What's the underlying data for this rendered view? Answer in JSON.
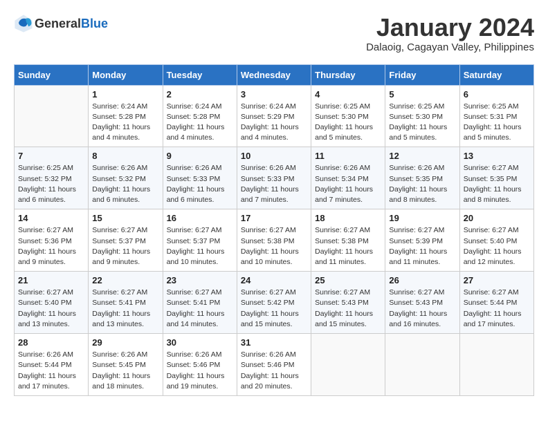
{
  "header": {
    "logo_general": "General",
    "logo_blue": "Blue",
    "month": "January 2024",
    "location": "Dalaoig, Cagayan Valley, Philippines"
  },
  "columns": [
    "Sunday",
    "Monday",
    "Tuesday",
    "Wednesday",
    "Thursday",
    "Friday",
    "Saturday"
  ],
  "weeks": [
    [
      {
        "num": "",
        "detail": ""
      },
      {
        "num": "1",
        "detail": "Sunrise: 6:24 AM\nSunset: 5:28 PM\nDaylight: 11 hours\nand 4 minutes."
      },
      {
        "num": "2",
        "detail": "Sunrise: 6:24 AM\nSunset: 5:28 PM\nDaylight: 11 hours\nand 4 minutes."
      },
      {
        "num": "3",
        "detail": "Sunrise: 6:24 AM\nSunset: 5:29 PM\nDaylight: 11 hours\nand 4 minutes."
      },
      {
        "num": "4",
        "detail": "Sunrise: 6:25 AM\nSunset: 5:30 PM\nDaylight: 11 hours\nand 5 minutes."
      },
      {
        "num": "5",
        "detail": "Sunrise: 6:25 AM\nSunset: 5:30 PM\nDaylight: 11 hours\nand 5 minutes."
      },
      {
        "num": "6",
        "detail": "Sunrise: 6:25 AM\nSunset: 5:31 PM\nDaylight: 11 hours\nand 5 minutes."
      }
    ],
    [
      {
        "num": "7",
        "detail": "Sunrise: 6:25 AM\nSunset: 5:32 PM\nDaylight: 11 hours\nand 6 minutes."
      },
      {
        "num": "8",
        "detail": "Sunrise: 6:26 AM\nSunset: 5:32 PM\nDaylight: 11 hours\nand 6 minutes."
      },
      {
        "num": "9",
        "detail": "Sunrise: 6:26 AM\nSunset: 5:33 PM\nDaylight: 11 hours\nand 6 minutes."
      },
      {
        "num": "10",
        "detail": "Sunrise: 6:26 AM\nSunset: 5:33 PM\nDaylight: 11 hours\nand 7 minutes."
      },
      {
        "num": "11",
        "detail": "Sunrise: 6:26 AM\nSunset: 5:34 PM\nDaylight: 11 hours\nand 7 minutes."
      },
      {
        "num": "12",
        "detail": "Sunrise: 6:26 AM\nSunset: 5:35 PM\nDaylight: 11 hours\nand 8 minutes."
      },
      {
        "num": "13",
        "detail": "Sunrise: 6:27 AM\nSunset: 5:35 PM\nDaylight: 11 hours\nand 8 minutes."
      }
    ],
    [
      {
        "num": "14",
        "detail": "Sunrise: 6:27 AM\nSunset: 5:36 PM\nDaylight: 11 hours\nand 9 minutes."
      },
      {
        "num": "15",
        "detail": "Sunrise: 6:27 AM\nSunset: 5:37 PM\nDaylight: 11 hours\nand 9 minutes."
      },
      {
        "num": "16",
        "detail": "Sunrise: 6:27 AM\nSunset: 5:37 PM\nDaylight: 11 hours\nand 10 minutes."
      },
      {
        "num": "17",
        "detail": "Sunrise: 6:27 AM\nSunset: 5:38 PM\nDaylight: 11 hours\nand 10 minutes."
      },
      {
        "num": "18",
        "detail": "Sunrise: 6:27 AM\nSunset: 5:38 PM\nDaylight: 11 hours\nand 11 minutes."
      },
      {
        "num": "19",
        "detail": "Sunrise: 6:27 AM\nSunset: 5:39 PM\nDaylight: 11 hours\nand 11 minutes."
      },
      {
        "num": "20",
        "detail": "Sunrise: 6:27 AM\nSunset: 5:40 PM\nDaylight: 11 hours\nand 12 minutes."
      }
    ],
    [
      {
        "num": "21",
        "detail": "Sunrise: 6:27 AM\nSunset: 5:40 PM\nDaylight: 11 hours\nand 13 minutes."
      },
      {
        "num": "22",
        "detail": "Sunrise: 6:27 AM\nSunset: 5:41 PM\nDaylight: 11 hours\nand 13 minutes."
      },
      {
        "num": "23",
        "detail": "Sunrise: 6:27 AM\nSunset: 5:41 PM\nDaylight: 11 hours\nand 14 minutes."
      },
      {
        "num": "24",
        "detail": "Sunrise: 6:27 AM\nSunset: 5:42 PM\nDaylight: 11 hours\nand 15 minutes."
      },
      {
        "num": "25",
        "detail": "Sunrise: 6:27 AM\nSunset: 5:43 PM\nDaylight: 11 hours\nand 15 minutes."
      },
      {
        "num": "26",
        "detail": "Sunrise: 6:27 AM\nSunset: 5:43 PM\nDaylight: 11 hours\nand 16 minutes."
      },
      {
        "num": "27",
        "detail": "Sunrise: 6:27 AM\nSunset: 5:44 PM\nDaylight: 11 hours\nand 17 minutes."
      }
    ],
    [
      {
        "num": "28",
        "detail": "Sunrise: 6:26 AM\nSunset: 5:44 PM\nDaylight: 11 hours\nand 17 minutes."
      },
      {
        "num": "29",
        "detail": "Sunrise: 6:26 AM\nSunset: 5:45 PM\nDaylight: 11 hours\nand 18 minutes."
      },
      {
        "num": "30",
        "detail": "Sunrise: 6:26 AM\nSunset: 5:46 PM\nDaylight: 11 hours\nand 19 minutes."
      },
      {
        "num": "31",
        "detail": "Sunrise: 6:26 AM\nSunset: 5:46 PM\nDaylight: 11 hours\nand 20 minutes."
      },
      {
        "num": "",
        "detail": ""
      },
      {
        "num": "",
        "detail": ""
      },
      {
        "num": "",
        "detail": ""
      }
    ]
  ]
}
